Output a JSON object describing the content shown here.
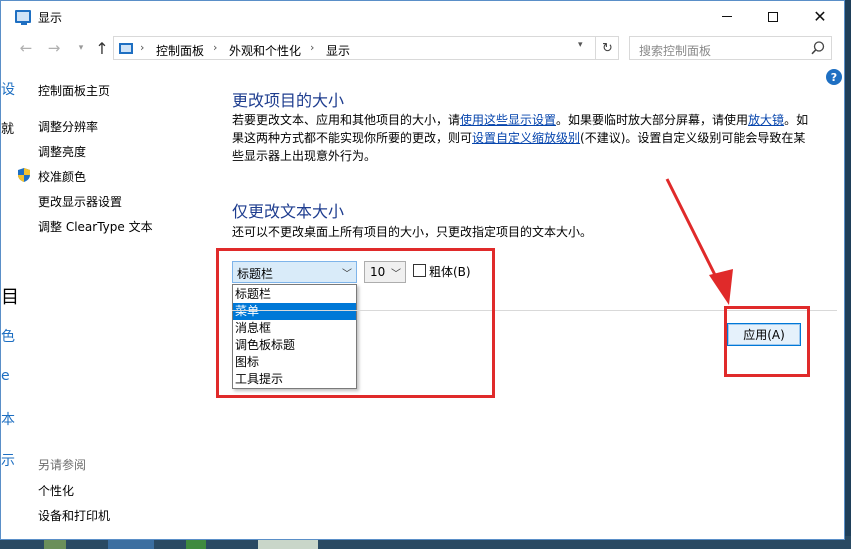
{
  "window": {
    "title": "显示"
  },
  "breadcrumb": {
    "items": [
      "控制面板",
      "外观和个性化",
      "显示"
    ]
  },
  "search": {
    "placeholder": "搜索控制面板"
  },
  "sidebar": {
    "home": "控制面板主页",
    "items": [
      "调整分辨率",
      "调整亮度",
      "校准颜色",
      "更改显示器设置",
      "调整 ClearType 文本"
    ],
    "see_also_title": "另请参阅",
    "see_also": [
      "个性化",
      "设备和打印机"
    ]
  },
  "section1": {
    "title": "更改项目的大小",
    "text_a": "若要更改文本、应用和其他项目的大小，请",
    "link_a": "使用这些显示设置",
    "text_b": "。如果要临时放大部分屏幕，请使用",
    "link_b": "放大镜",
    "text_c": "。如果这两种方式都不能实现你所要的更改，则可",
    "link_c": "设置自定义缩放级别",
    "text_d": "(不建议)。设置自定义级别可能会导致在某些显示器上出现意外行为。"
  },
  "section2": {
    "title": "仅更改文本大小",
    "description": "还可以不更改桌面上所有项目的大小，只更改指定项目的文本大小。"
  },
  "controls": {
    "item_select_value": "标题栏",
    "item_options": [
      "标题栏",
      "菜单",
      "消息框",
      "调色板标题",
      "图标",
      "工具提示"
    ],
    "highlighted_option": "菜单",
    "size_value": "10",
    "bold_label": "粗体(B)",
    "bold_checked": false,
    "apply_label": "应用(A)"
  },
  "help": {
    "label": "?"
  },
  "colors": {
    "accent": "#0078d7",
    "heading": "#1e3d8f",
    "link": "#0645ad",
    "annotation": "#e02a2a"
  }
}
